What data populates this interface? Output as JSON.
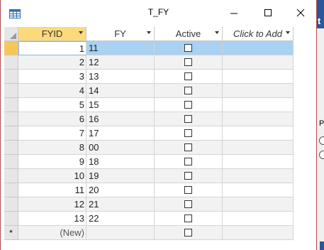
{
  "window": {
    "title": "T_FY"
  },
  "controls": {
    "minimize": "—",
    "maximize": "☐",
    "close": "✕"
  },
  "columns": [
    {
      "label": "FYID"
    },
    {
      "label": "FY"
    },
    {
      "label": "Active"
    },
    {
      "label": "Click to Add"
    }
  ],
  "rows": [
    {
      "fyid": "1",
      "fy": "11",
      "active": false
    },
    {
      "fyid": "2",
      "fy": "12",
      "active": false
    },
    {
      "fyid": "3",
      "fy": "13",
      "active": false
    },
    {
      "fyid": "4",
      "fy": "14",
      "active": false
    },
    {
      "fyid": "5",
      "fy": "15",
      "active": false
    },
    {
      "fyid": "6",
      "fy": "16",
      "active": false
    },
    {
      "fyid": "7",
      "fy": "17",
      "active": false
    },
    {
      "fyid": "8",
      "fy": "00",
      "active": false
    },
    {
      "fyid": "9",
      "fy": "18",
      "active": false
    },
    {
      "fyid": "10",
      "fy": "19",
      "active": false
    },
    {
      "fyid": "11",
      "fy": "20",
      "active": false
    },
    {
      "fyid": "12",
      "fy": "21",
      "active": false
    },
    {
      "fyid": "13",
      "fy": "22",
      "active": false
    }
  ],
  "new_row": {
    "marker": "*",
    "fyid": "(New)"
  },
  "background_app": {
    "label": "Pr",
    "title_char": "t"
  },
  "colors": {
    "header_selected": "#fcd97b",
    "row_selected": "#a9d1f2",
    "accent_blue": "#2b579a"
  }
}
